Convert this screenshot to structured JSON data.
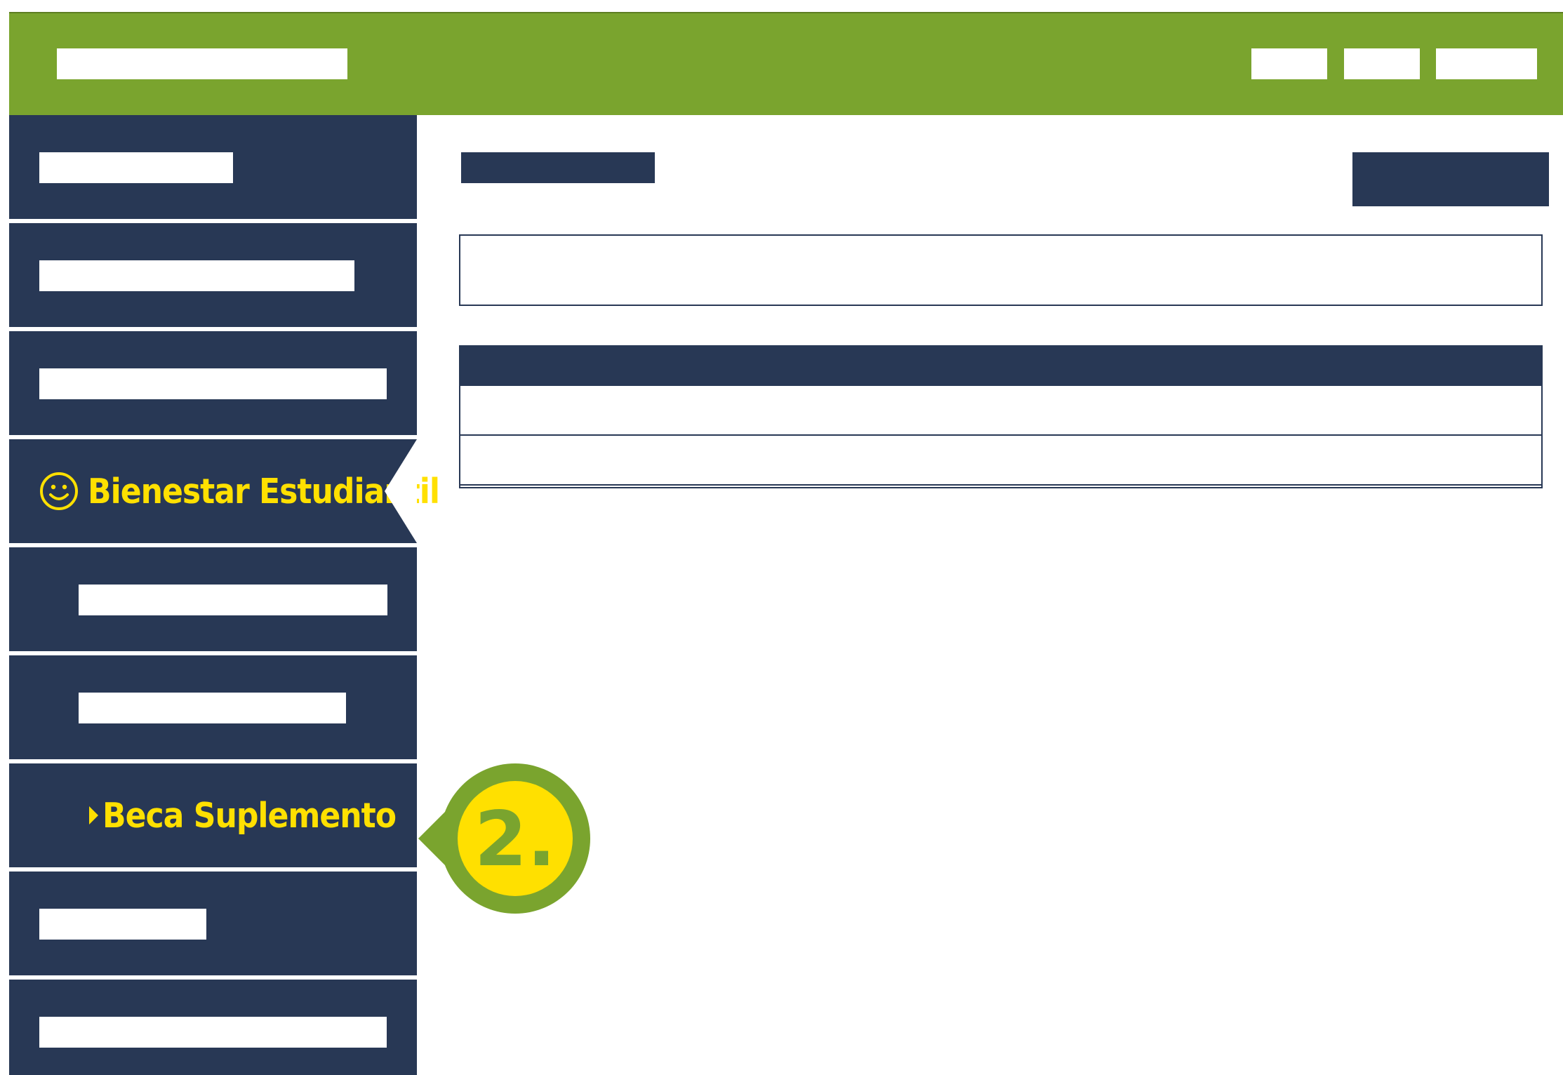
{
  "sidebar": {
    "items": [
      {
        "label": "Bienestar Estudiantil",
        "icon": "smiley-icon",
        "active": true
      },
      {
        "label": "Beca Suplemento",
        "icon": "caret-right-icon"
      }
    ]
  },
  "callout": {
    "step": "2."
  },
  "colors": {
    "topbar": "#7aa42e",
    "navy": "#283855",
    "highlight": "#ffe000",
    "callout_ring": "#7aa42e"
  }
}
